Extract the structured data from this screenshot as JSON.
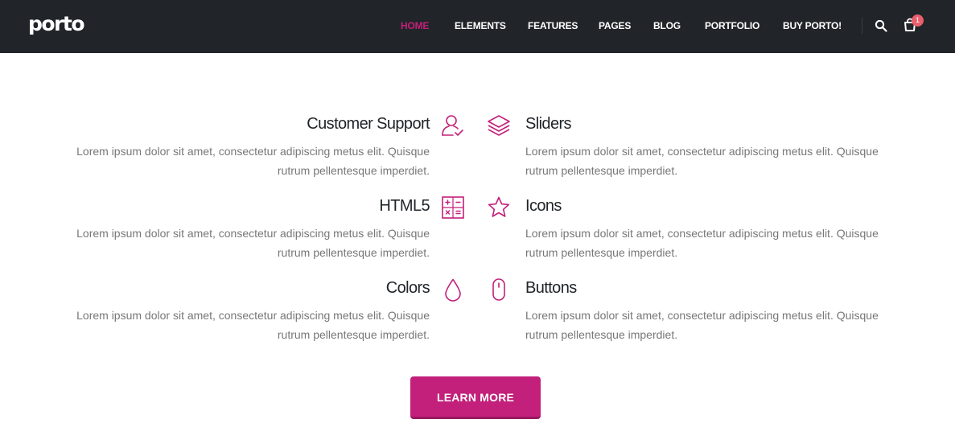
{
  "brand": {
    "logo": "porto"
  },
  "nav": {
    "items": [
      {
        "label": "HOME",
        "active": true
      },
      {
        "label": "ELEMENTS",
        "active": false
      },
      {
        "label": "FEATURES",
        "active": false
      },
      {
        "label": "PAGES",
        "active": false
      },
      {
        "label": "BLOG",
        "active": false
      },
      {
        "label": "PORTFOLIO",
        "active": false
      },
      {
        "label": "BUY PORTO!",
        "active": false
      }
    ],
    "cart_count": "1"
  },
  "features": {
    "left": [
      {
        "title": "Customer Support",
        "text": "Lorem ipsum dolor sit amet, consectetur adipiscing metus elit. Quisque rutrum pellentesque imperdiet.",
        "icon": "user-check-icon"
      },
      {
        "title": "HTML5",
        "text": "Lorem ipsum dolor sit amet, consectetur adipiscing metus elit. Quisque rutrum pellentesque imperdiet.",
        "icon": "calculator-icon"
      },
      {
        "title": "Colors",
        "text": "Lorem ipsum dolor sit amet, consectetur adipiscing metus elit. Quisque rutrum pellentesque imperdiet.",
        "icon": "drop-icon"
      }
    ],
    "right": [
      {
        "title": "Sliders",
        "text": "Lorem ipsum dolor sit amet, consectetur adipiscing metus elit. Quisque rutrum pellentesque imperdiet.",
        "icon": "layers-icon"
      },
      {
        "title": "Icons",
        "text": "Lorem ipsum dolor sit amet, consectetur adipiscing metus elit. Quisque rutrum pellentesque imperdiet.",
        "icon": "star-icon"
      },
      {
        "title": "Buttons",
        "text": "Lorem ipsum dolor sit amet, consectetur adipiscing metus elit. Quisque rutrum pellentesque imperdiet.",
        "icon": "mouse-icon"
      }
    ]
  },
  "cta": {
    "label": "LEARN MORE"
  },
  "colors": {
    "primary": "#c2207a",
    "header_bg": "#212529",
    "badge": "#e95f6c",
    "text_muted": "#777777"
  }
}
